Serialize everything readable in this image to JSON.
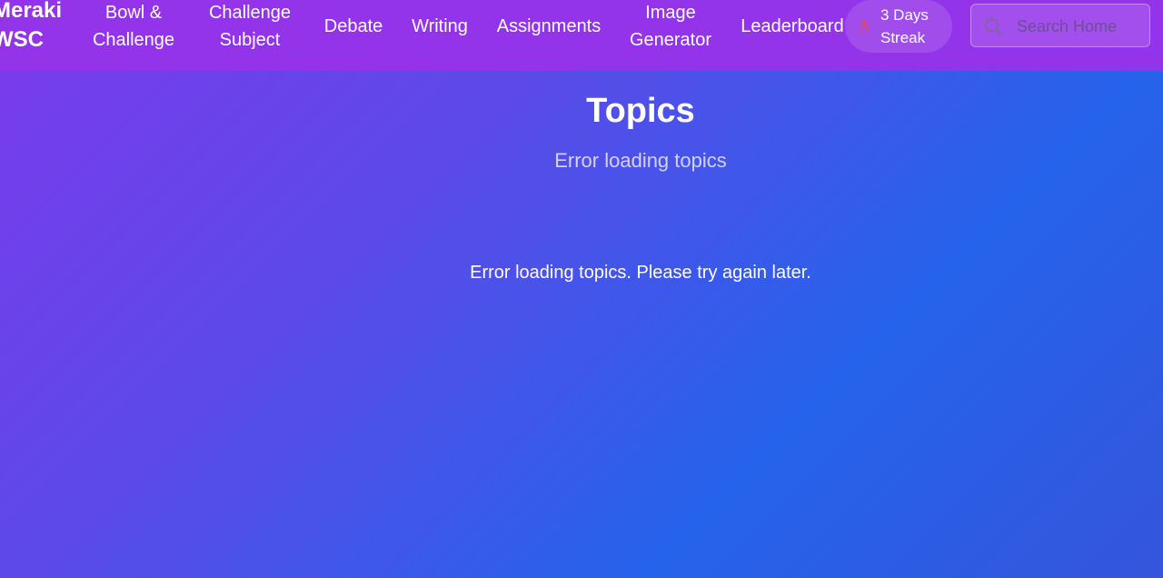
{
  "nav": {
    "brand": "Meraki WSC",
    "items": [
      {
        "label": "Bowl & Challenge"
      },
      {
        "label": "Challenge Subject"
      },
      {
        "label": "Debate"
      },
      {
        "label": "Writing"
      },
      {
        "label": "Assignments"
      },
      {
        "label": "Image Generator"
      },
      {
        "label": "Leaderboard"
      }
    ],
    "streak": {
      "label": "3 Days Streak",
      "icon": "flame-icon"
    },
    "search": {
      "placeholder": "Search Home",
      "icon": "search-icon"
    }
  },
  "main": {
    "title": "Topics",
    "subtitle": "Error loading topics",
    "error_message": "Error loading topics. Please try again later."
  },
  "colors": {
    "navbar": "#9333ea",
    "gradient_start": "#7c3aed",
    "gradient_end": "#2563eb",
    "flame": "#ef4444"
  }
}
